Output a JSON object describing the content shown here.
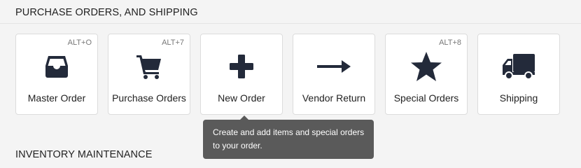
{
  "sections": {
    "top_title": "PURCHASE ORDERS, AND SHIPPING",
    "bottom_title": "INVENTORY MAINTENANCE"
  },
  "tiles": [
    {
      "label": "Master Order",
      "shortcut": "ALT+O",
      "icon": "inbox-tray-icon"
    },
    {
      "label": "Purchase Orders",
      "shortcut": "ALT+7",
      "icon": "shopping-cart-icon"
    },
    {
      "label": "New Order",
      "shortcut": "",
      "icon": "plus-icon"
    },
    {
      "label": "Vendor Return",
      "shortcut": "",
      "icon": "arrow-right-icon"
    },
    {
      "label": "Special Orders",
      "shortcut": "ALT+8",
      "icon": "star-icon"
    },
    {
      "label": "Shipping",
      "shortcut": "",
      "icon": "truck-icon"
    }
  ],
  "tooltip": {
    "text": "Create and add items and special orders to your order."
  },
  "colors": {
    "icon": "#232a3a",
    "tooltip_bg": "#5a5a5a",
    "page_bg": "#f4f4f4"
  }
}
